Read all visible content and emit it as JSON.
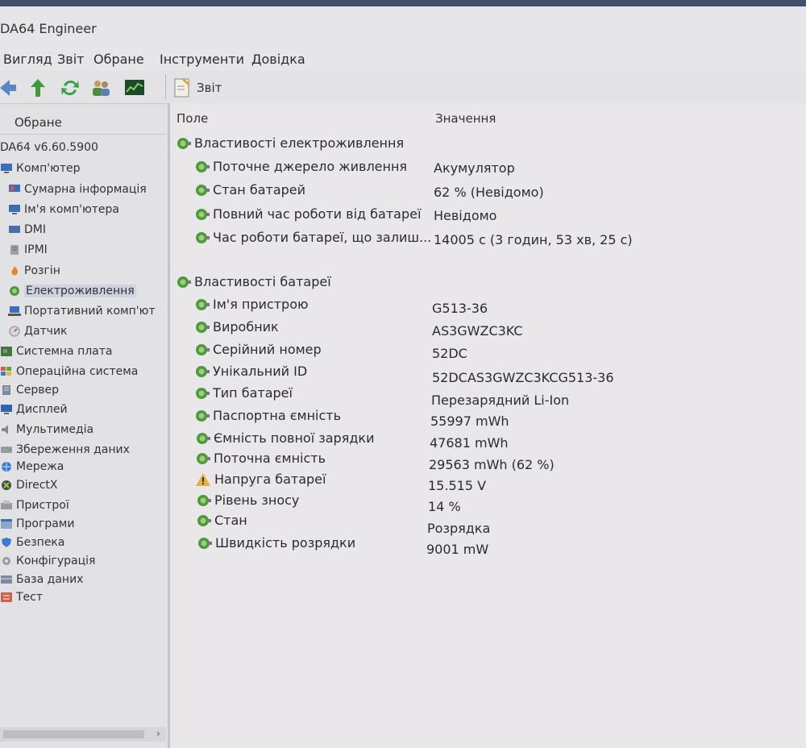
{
  "app": {
    "title": "DA64 Engineer"
  },
  "menu": [
    "Вигляд",
    "Звіт",
    "Обране",
    "Інструменти",
    "Довідка"
  ],
  "toolbar": {
    "report_label": "Звіт"
  },
  "left_panel": {
    "header": "Обране",
    "version": "DA64 v6.60.5900",
    "items": [
      "Комп'ютер",
      "Сумарна інформація",
      "Ім'я комп'ютера",
      "DMI",
      "IPMI",
      "Розгін",
      "Електроживлення",
      "Портативний комп'ют",
      "Датчик",
      "Системна плата",
      "Операційна система",
      "Сервер",
      "Дисплей",
      "Мультимедіа",
      "Збереження даних",
      "Мережа",
      "DirectX",
      "Пристрої",
      "Програми",
      "Безпека",
      "Конфігурація",
      "База даних",
      "Тест"
    ]
  },
  "columns": {
    "field": "Поле",
    "value": "Значення"
  },
  "sections": {
    "power": {
      "title": "Властивості електроживлення",
      "rows": [
        {
          "label": "Поточне джерело живлення",
          "value": "Акумулятор"
        },
        {
          "label": "Стан батарей",
          "value": "62 % (Невідомо)"
        },
        {
          "label": "Повний час роботи від батареї",
          "value": "Невідомо"
        },
        {
          "label": "Час роботи батареї, що залиш...",
          "value": "14005 с (3 годин, 53 хв, 25 с)"
        }
      ]
    },
    "battery": {
      "title": "Властивості батареї",
      "rows": [
        {
          "label": "Ім'я пристрою",
          "value": "G513-36"
        },
        {
          "label": "Виробник",
          "value": "AS3GWZC3KC"
        },
        {
          "label": "Серійний номер",
          "value": "52DC"
        },
        {
          "label": "Унікальний ID",
          "value": "52DCAS3GWZC3KCG513-36"
        },
        {
          "label": "Тип батареї",
          "value": "Перезарядний Li-Ion"
        },
        {
          "label": "Паспортна ємність",
          "value": "55997 mWh"
        },
        {
          "label": "Ємність повної зарядки",
          "value": "47681 mWh"
        },
        {
          "label": "Поточна ємність",
          "value": "29563 mWh  (62 %)"
        },
        {
          "label": "Напруга батареї",
          "value": "15.515 V"
        },
        {
          "label": "Рівень зносу",
          "value": "14 %"
        },
        {
          "label": "Стан",
          "value": "Розрядка"
        },
        {
          "label": "Швидкість розрядки",
          "value": "9001 mW"
        }
      ]
    }
  }
}
